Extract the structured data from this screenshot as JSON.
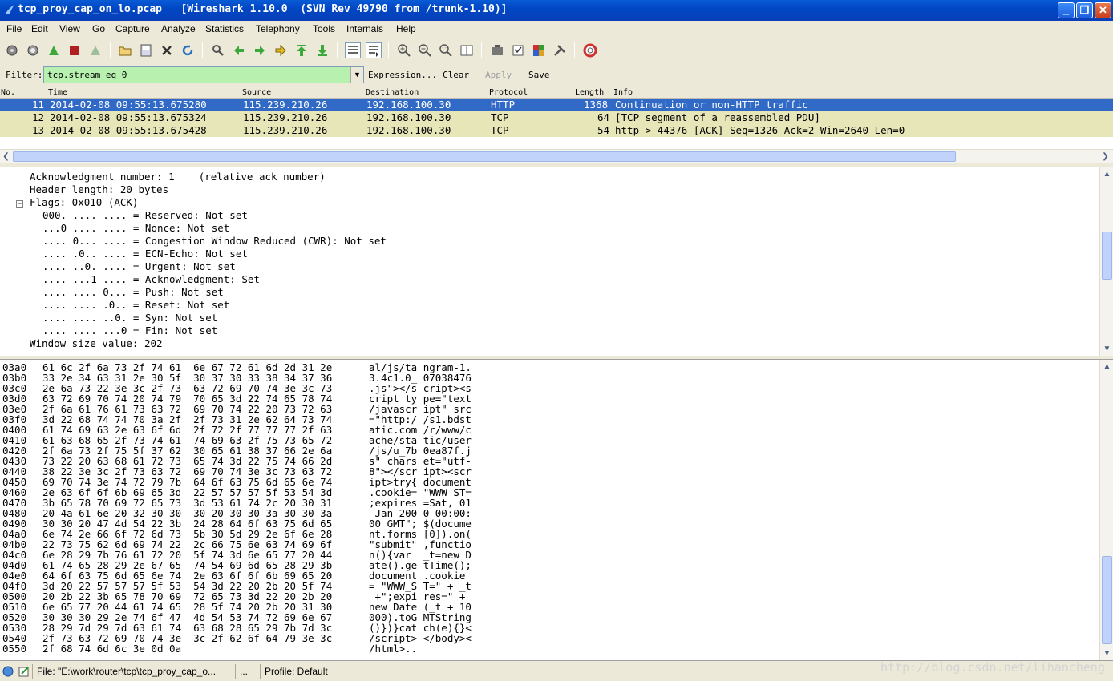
{
  "window": {
    "title": "tcp_proy_cap_on_lo.pcap   [Wireshark 1.10.0  (SVN Rev 49790 from /trunk-1.10)]",
    "minimize": "_",
    "maximize": "❐",
    "close": "✕"
  },
  "menu": [
    "File",
    "Edit",
    "View",
    "Go",
    "Capture",
    "Analyze",
    "Statistics",
    "Telephony",
    "Tools",
    "Internals",
    "Help"
  ],
  "filter": {
    "label": "Filter:",
    "value": "tcp.stream eq 0",
    "expression": "Expression...",
    "clear": "Clear",
    "apply": "Apply",
    "save": "Save"
  },
  "packet_list": {
    "headers": [
      "No.",
      "Time",
      "Source",
      "Destination",
      "Protocol",
      "Length",
      "Info"
    ],
    "rows": [
      {
        "no": "11",
        "time": "2014-02-08 09:55:13.675280",
        "src": "115.239.210.26",
        "dst": "192.168.100.30",
        "proto": "HTTP",
        "len": "1368",
        "info": "Continuation or non-HTTP traffic"
      },
      {
        "no": "12",
        "time": "2014-02-08 09:55:13.675324",
        "src": "115.239.210.26",
        "dst": "192.168.100.30",
        "proto": "TCP",
        "len": "64",
        "info": "[TCP segment of a reassembled PDU]"
      },
      {
        "no": "13",
        "time": "2014-02-08 09:55:13.675428",
        "src": "115.239.210.26",
        "dst": "192.168.100.30",
        "proto": "TCP",
        "len": "54",
        "info": "http > 44376 [ACK] Seq=1326 Ack=2 Win=2640 Len=0"
      }
    ]
  },
  "colors": {
    "selected_row": "#3169c6",
    "tcp_row": "#e7e6b8",
    "filter_bg": "#b8f0b0"
  },
  "details": {
    "ack": "Acknowledgment number: 1    (relative ack number)",
    "header_len": "Header length: 20 bytes",
    "flags": "Flags: 0x010 (ACK)",
    "flag_lines": [
      "000. .... .... = Reserved: Not set",
      "...0 .... .... = Nonce: Not set",
      ".... 0... .... = Congestion Window Reduced (CWR): Not set",
      ".... .0.. .... = ECN-Echo: Not set",
      ".... ..0. .... = Urgent: Not set",
      ".... ...1 .... = Acknowledgment: Set",
      ".... .... 0... = Push: Not set",
      ".... .... .0.. = Reset: Not set",
      ".... .... ..0. = Syn: Not set",
      ".... .... ...0 = Fin: Not set"
    ],
    "window": "Window size value: 202"
  },
  "bytes": [
    {
      "off": "03a0",
      "hex": "61 6c 2f 6a 73 2f 74 61  6e 67 72 61 6d 2d 31 2e",
      "ascii": "al/js/ta ngram-1."
    },
    {
      "off": "03b0",
      "hex": "33 2e 34 63 31 2e 30 5f  30 37 30 33 38 34 37 36",
      "ascii": "3.4c1.0_ 07038476"
    },
    {
      "off": "03c0",
      "hex": "2e 6a 73 22 3e 3c 2f 73  63 72 69 70 74 3e 3c 73",
      "ascii": ".js\"></s cript><s"
    },
    {
      "off": "03d0",
      "hex": "63 72 69 70 74 20 74 79  70 65 3d 22 74 65 78 74",
      "ascii": "cript ty pe=\"text"
    },
    {
      "off": "03e0",
      "hex": "2f 6a 61 76 61 73 63 72  69 70 74 22 20 73 72 63",
      "ascii": "/javascr ipt\" src"
    },
    {
      "off": "03f0",
      "hex": "3d 22 68 74 74 70 3a 2f  2f 73 31 2e 62 64 73 74",
      "ascii": "=\"http:/ /s1.bdst"
    },
    {
      "off": "0400",
      "hex": "61 74 69 63 2e 63 6f 6d  2f 72 2f 77 77 77 2f 63",
      "ascii": "atic.com /r/www/c"
    },
    {
      "off": "0410",
      "hex": "61 63 68 65 2f 73 74 61  74 69 63 2f 75 73 65 72",
      "ascii": "ache/sta tic/user"
    },
    {
      "off": "0420",
      "hex": "2f 6a 73 2f 75 5f 37 62  30 65 61 38 37 66 2e 6a",
      "ascii": "/js/u_7b 0ea87f.j"
    },
    {
      "off": "0430",
      "hex": "73 22 20 63 68 61 72 73  65 74 3d 22 75 74 66 2d",
      "ascii": "s\" chars et=\"utf-"
    },
    {
      "off": "0440",
      "hex": "38 22 3e 3c 2f 73 63 72  69 70 74 3e 3c 73 63 72",
      "ascii": "8\"></scr ipt><scr"
    },
    {
      "off": "0450",
      "hex": "69 70 74 3e 74 72 79 7b  64 6f 63 75 6d 65 6e 74",
      "ascii": "ipt>try{ document"
    },
    {
      "off": "0460",
      "hex": "2e 63 6f 6f 6b 69 65 3d  22 57 57 57 5f 53 54 3d",
      "ascii": ".cookie= \"WWW_ST="
    },
    {
      "off": "0470",
      "hex": "3b 65 78 70 69 72 65 73  3d 53 61 74 2c 20 30 31",
      "ascii": ";expires =Sat, 01"
    },
    {
      "off": "0480",
      "hex": "20 4a 61 6e 20 32 30 30  30 20 30 30 3a 30 30 3a",
      "ascii": " Jan 200 0 00:00:"
    },
    {
      "off": "0490",
      "hex": "30 30 20 47 4d 54 22 3b  24 28 64 6f 63 75 6d 65",
      "ascii": "00 GMT\"; $(docume"
    },
    {
      "off": "04a0",
      "hex": "6e 74 2e 66 6f 72 6d 73  5b 30 5d 29 2e 6f 6e 28",
      "ascii": "nt.forms [0]).on("
    },
    {
      "off": "04b0",
      "hex": "22 73 75 62 6d 69 74 22  2c 66 75 6e 63 74 69 6f",
      "ascii": "\"submit\" ,functio"
    },
    {
      "off": "04c0",
      "hex": "6e 28 29 7b 76 61 72 20  5f 74 3d 6e 65 77 20 44",
      "ascii": "n(){var  _t=new D"
    },
    {
      "off": "04d0",
      "hex": "61 74 65 28 29 2e 67 65  74 54 69 6d 65 28 29 3b",
      "ascii": "ate().ge tTime();"
    },
    {
      "off": "04e0",
      "hex": "64 6f 63 75 6d 65 6e 74  2e 63 6f 6f 6b 69 65 20",
      "ascii": "document .cookie "
    },
    {
      "off": "04f0",
      "hex": "3d 20 22 57 57 57 5f 53  54 3d 22 20 2b 20 5f 74",
      "ascii": "= \"WWW_S T=\" + _t"
    },
    {
      "off": "0500",
      "hex": "20 2b 22 3b 65 78 70 69  72 65 73 3d 22 20 2b 20",
      "ascii": " +\";expi res=\" + "
    },
    {
      "off": "0510",
      "hex": "6e 65 77 20 44 61 74 65  28 5f 74 20 2b 20 31 30",
      "ascii": "new Date (_t + 10"
    },
    {
      "off": "0520",
      "hex": "30 30 30 29 2e 74 6f 47  4d 54 53 74 72 69 6e 67",
      "ascii": "000).toG MTString"
    },
    {
      "off": "0530",
      "hex": "28 29 7d 29 7d 63 61 74  63 68 28 65 29 7b 7d 3c",
      "ascii": "()})}cat ch(e){}<"
    },
    {
      "off": "0540",
      "hex": "2f 73 63 72 69 70 74 3e  3c 2f 62 6f 64 79 3e 3c",
      "ascii": "/script> </body><"
    },
    {
      "off": "0550",
      "hex": "2f 68 74 6d 6c 3e 0d 0a",
      "ascii": "/html>.."
    }
  ],
  "status": {
    "file": "File: \"E:\\work\\router\\tcp\\tcp_proy_cap_o...",
    "ellipsis": "...",
    "profile": "Profile: Default"
  },
  "watermark": "http://blog.csdn.net/lihancheng"
}
